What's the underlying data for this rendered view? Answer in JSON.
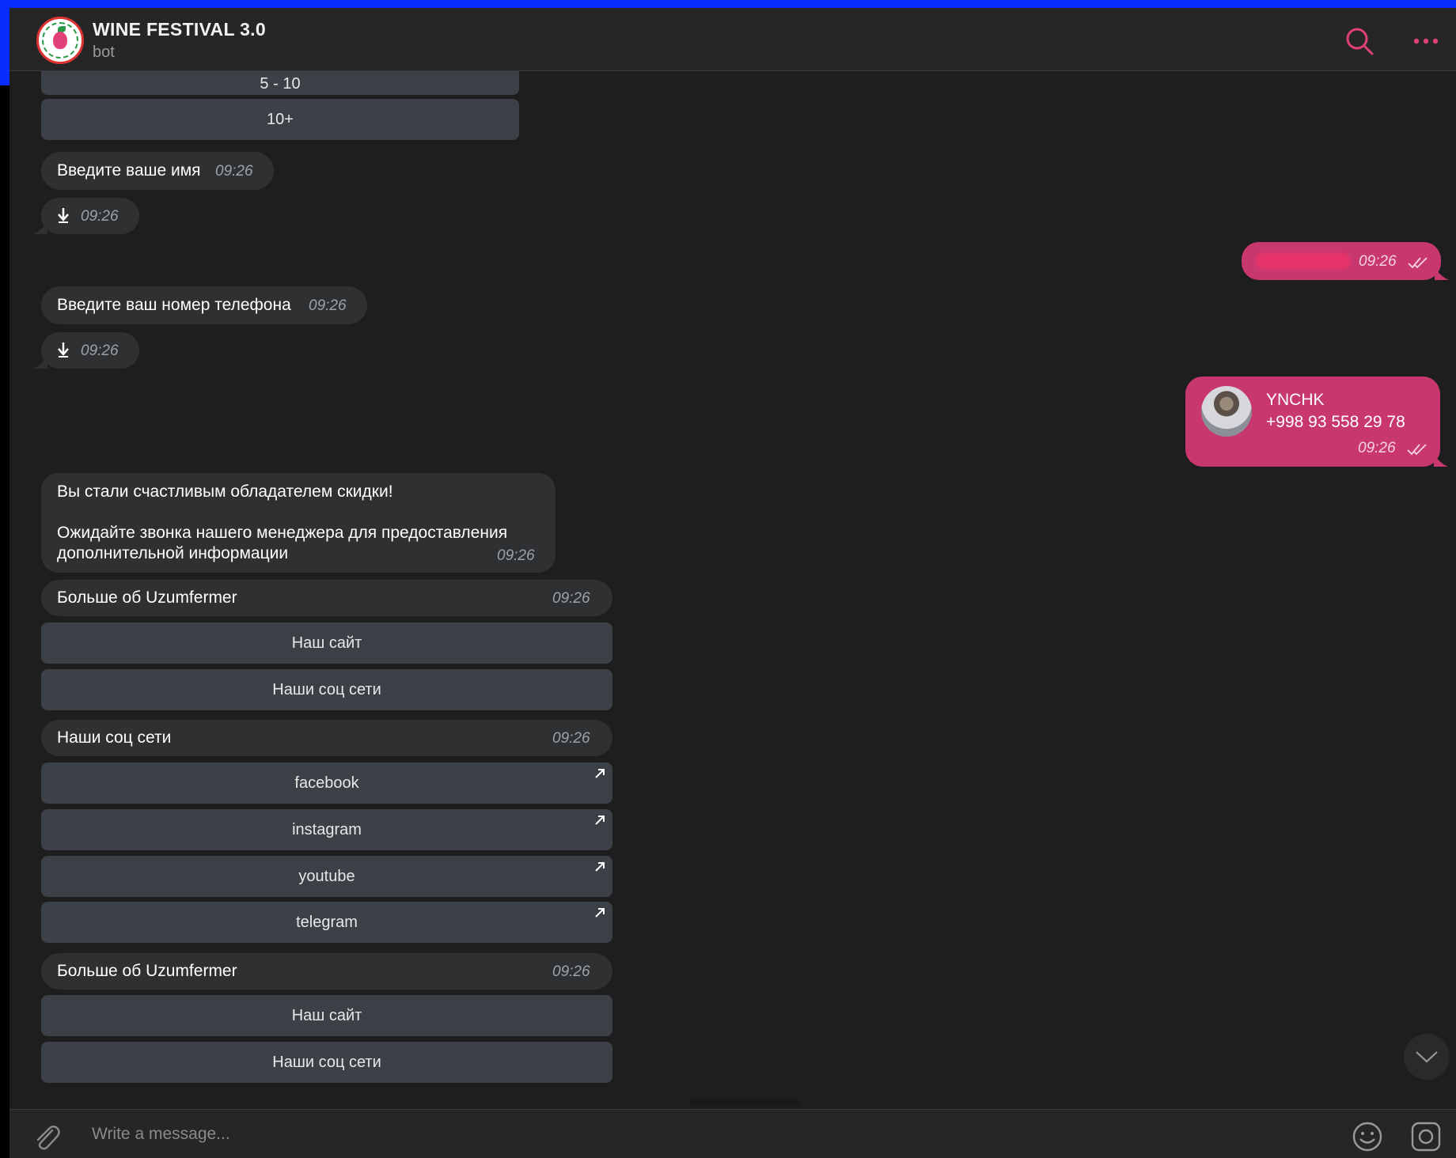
{
  "header": {
    "title": "WINE FESTIVAL 3.0",
    "subtitle": "bot"
  },
  "top_keyboard": [
    {
      "label": "5 - 10"
    },
    {
      "label": "10+"
    }
  ],
  "messages": {
    "ask_name": {
      "text": "Введите ваше имя",
      "time": "09:26"
    },
    "ask_name_file": {
      "time": "09:26"
    },
    "reply_name": {
      "time": "09:26"
    },
    "ask_phone": {
      "text": "Введите ваш номер телефона",
      "time": "09:26"
    },
    "ask_phone_file": {
      "time": "09:26"
    },
    "contact": {
      "name": "YNCHK",
      "phone": "+998 93 558 29 78",
      "time": "09:26"
    },
    "discount": {
      "line1": "Вы стали счастливым обладателем скидки!",
      "line2": "Ожидайте звонка нашего менеджера для предоставления",
      "line3": "дополнительной информации",
      "time": "09:26"
    },
    "more1": {
      "text": "Больше об Uzumfermer",
      "time": "09:26"
    },
    "more1_buttons": [
      {
        "label": "Наш сайт"
      },
      {
        "label": "Наши соц сети"
      }
    ],
    "social": {
      "text": "Наши соц сети",
      "time": "09:26"
    },
    "social_buttons": [
      {
        "label": "facebook"
      },
      {
        "label": "instagram"
      },
      {
        "label": "youtube"
      },
      {
        "label": "telegram"
      }
    ],
    "more2": {
      "text": "Больше об Uzumfermer",
      "time": "09:26"
    },
    "more2_buttons": [
      {
        "label": "Наш сайт"
      },
      {
        "label": "Наши соц сети"
      }
    ]
  },
  "composer": {
    "placeholder": "Write a message..."
  },
  "colors": {
    "accent": "#c8386f",
    "header_icon": "#e0407a",
    "keyboard_button": "#3c4147",
    "bubble": "#2f3032",
    "background": "#1e1e1e"
  },
  "icons": [
    "search-icon",
    "more-icon",
    "download-icon",
    "double-check-icon",
    "external-link-icon",
    "chevron-down-icon",
    "attach-icon",
    "emoji-icon",
    "sticker-icon"
  ]
}
